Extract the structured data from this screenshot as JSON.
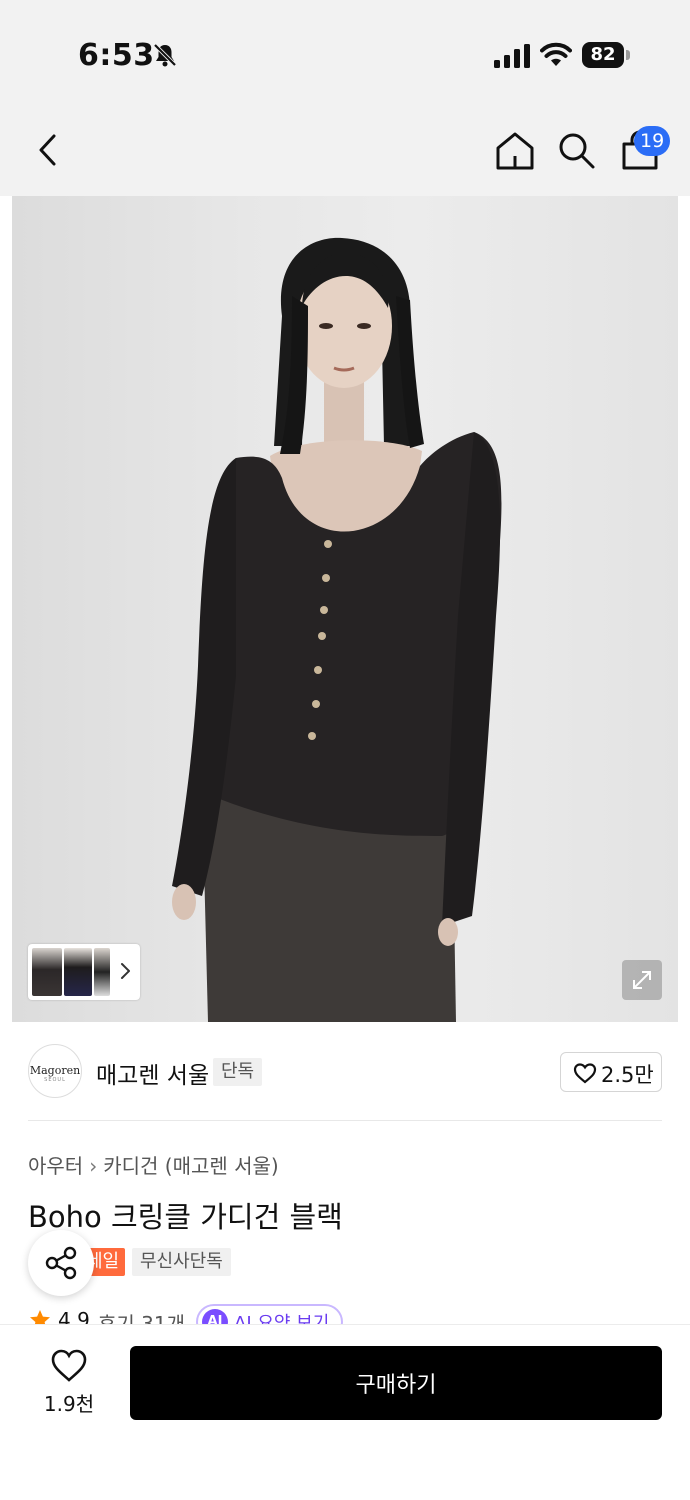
{
  "status_bar": {
    "time": "6:53",
    "battery": "82",
    "icons": [
      "bell-slash-icon",
      "signal-icon",
      "wifi-icon",
      "battery-icon"
    ]
  },
  "nav": {
    "icons": [
      "back-icon",
      "home-icon",
      "search-icon",
      "shopping-bag-icon"
    ],
    "cart_badge": "19",
    "badge_color": "#2b6df6"
  },
  "gallery": {
    "icons": [
      "chevron-right-icon",
      "expand-icon"
    ]
  },
  "brand": {
    "logo_text": "Magoren",
    "logo_sub": "SEOUL",
    "name": "매고렌 서울",
    "badge": "단독",
    "like_count": "2.5만"
  },
  "product": {
    "breadcrumb": [
      "아우터",
      "카디건 (매고렌 서울)"
    ],
    "title": "Boho 크링클 가디건 블랙",
    "tags": [
      "세일",
      "무신사단독"
    ],
    "sale_color": "#ff6a3c",
    "rating": "4.9",
    "review": "후기 31개",
    "ai_badge": "AI",
    "ai_label": "AI 요약 보기"
  },
  "bottom_bar": {
    "wish_count": "1.9천",
    "buy_label": "구매하기"
  }
}
